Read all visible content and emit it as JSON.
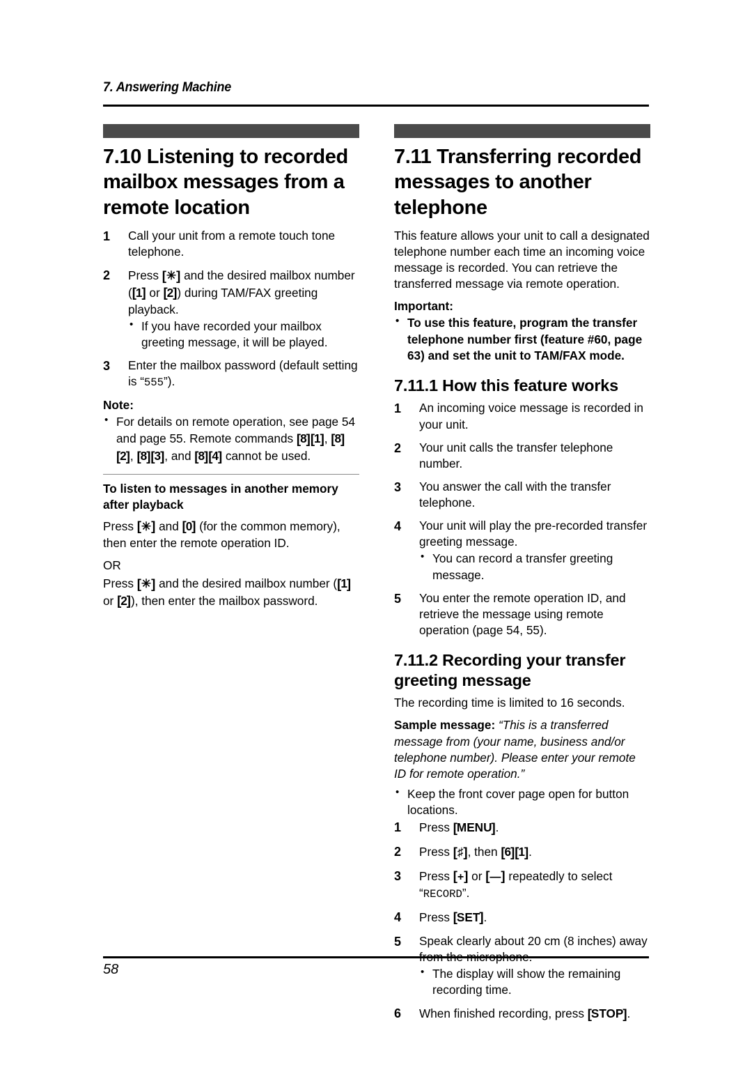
{
  "header": {
    "chapter": "7. Answering Machine"
  },
  "footer": {
    "page_number": "58"
  },
  "left_column": {
    "section_number_title": "7.10 Listening to recorded mailbox messages from a remote location",
    "steps": [
      {
        "num": "1",
        "text": "Call your unit from a remote touch tone telephone."
      },
      {
        "num": "2",
        "text_before": "Press ",
        "key1": "✳",
        "text_mid1": " and the desired mailbox number (",
        "key2": "1",
        "text_mid2": " or ",
        "key3": "2",
        "text_after": ") during TAM/FAX greeting playback.",
        "bullets": [
          "If you have recorded your mailbox greeting message, it will be played."
        ]
      },
      {
        "num": "3",
        "text_before": "Enter the mailbox password (default setting is “",
        "mono": "555",
        "text_after": "”)."
      }
    ],
    "note_label": "Note:",
    "note_bullet": {
      "text_before": "For details on remote operation, see page 54 and page 55. Remote commands ",
      "cmd1_a": "8",
      "cmd1_b": "1",
      "sep1": ", ",
      "cmd2_a": "8",
      "cmd2_b": "2",
      "sep2": ", ",
      "cmd3_a": "8",
      "cmd3_b": "3",
      "sep3": ", and ",
      "cmd4_a": "8",
      "cmd4_b": "4",
      "text_after": " cannot be used."
    },
    "subhead": "To listen to messages in another memory after playback",
    "press_para_1": {
      "text_before": "Press ",
      "key1": "✳",
      "text_mid": " and ",
      "key2": "0",
      "text_after": " (for the common memory), then enter the remote operation ID."
    },
    "or_text": "OR",
    "press_para_2": {
      "text_before": "Press ",
      "key1": "✳",
      "text_mid1": " and the desired mailbox number (",
      "key2": "1",
      "text_mid2": " or ",
      "key3": "2",
      "text_after": "), then enter the mailbox password."
    }
  },
  "right_column": {
    "section_number_title": "7.11 Transferring recorded messages to another telephone",
    "intro": "This feature allows your unit to call a designated telephone number each time an incoming voice message is recorded. You can retrieve the transferred message via remote operation.",
    "important_label": "Important:",
    "important_bullets": [
      "To use this feature, program the transfer telephone number first (feature #60, page 63) and set the unit to TAM/FAX mode."
    ],
    "sub1": {
      "title": "7.11.1 How this feature works",
      "steps": [
        {
          "num": "1",
          "text": "An incoming voice message is recorded in your unit."
        },
        {
          "num": "2",
          "text": "Your unit calls the transfer telephone number."
        },
        {
          "num": "3",
          "text": "You answer the call with the transfer telephone."
        },
        {
          "num": "4",
          "text": "Your unit will play the pre-recorded transfer greeting message.",
          "bullets": [
            "You can record a transfer greeting message."
          ]
        },
        {
          "num": "5",
          "text": "You enter the remote operation ID, and retrieve the message using remote operation (page 54, 55)."
        }
      ]
    },
    "sub2": {
      "title": "7.11.2 Recording your transfer greeting message",
      "intro": "The recording time is limited to 16 seconds.",
      "sample_label": "Sample message:",
      "sample_text": "“This is a transferred message from (your name, business and/or telephone number). Please enter your remote ID for remote operation.”",
      "pre_bullets": [
        "Keep the front cover page open for button locations."
      ],
      "steps": [
        {
          "num": "1",
          "text_before": "Press ",
          "key1": "MENU",
          "text_after": "."
        },
        {
          "num": "2",
          "text_before": "Press ",
          "key1": "♯",
          "text_mid": ", then ",
          "key2": "6",
          "key3": "1",
          "text_after": "."
        },
        {
          "num": "3",
          "text_before": "Press ",
          "key1": "+",
          "text_mid": " or ",
          "key2": "—",
          "text_after": " repeatedly to select ",
          "quote_open": "“",
          "mono": "RECORD",
          "quote_close": "”."
        },
        {
          "num": "4",
          "text_before": "Press ",
          "key1": "SET",
          "text_after": "."
        },
        {
          "num": "5",
          "text": "Speak clearly about 20 cm (8 inches) away from the microphone.",
          "bullets": [
            "The display will show the remaining recording time."
          ]
        },
        {
          "num": "6",
          "text_before": "When finished recording, press ",
          "key1": "STOP",
          "text_after": "."
        }
      ]
    }
  }
}
